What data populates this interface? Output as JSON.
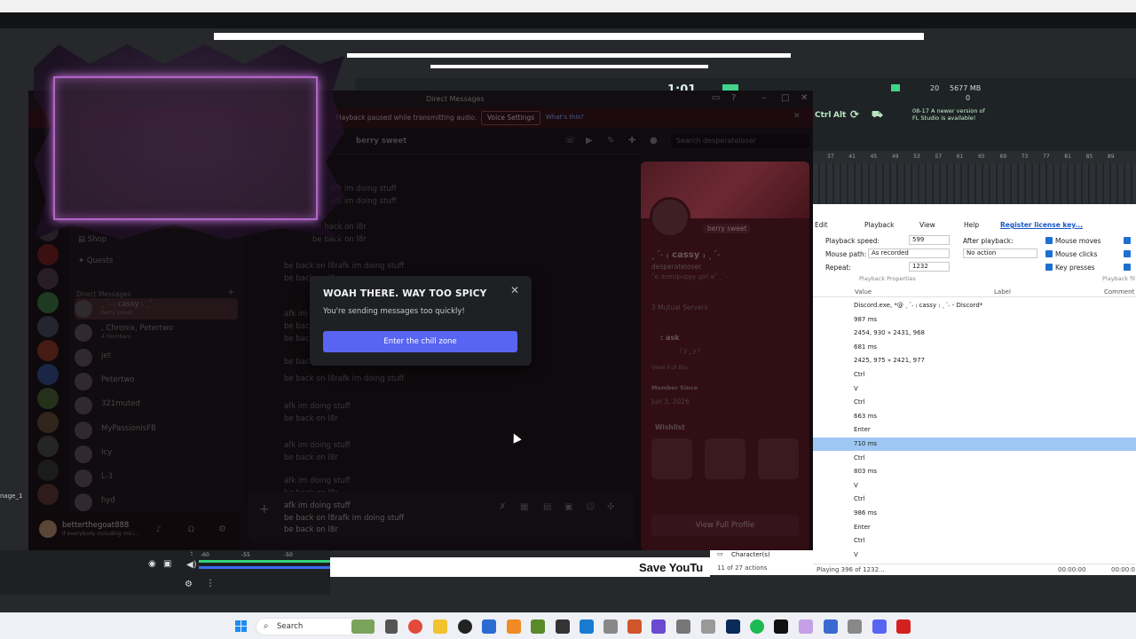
{
  "fl_studio": {
    "time_display": "1:01",
    "cpu": "20",
    "memory": "5677 MB",
    "mem_sub": "0",
    "key_ctrl": "Ctrl",
    "key_alt": "Alt",
    "notice_date": "08-17",
    "notice_line1": "A newer version of",
    "notice_line2": "FL Studio is available!",
    "ruler": [
      "37",
      "41",
      "45",
      "49",
      "53",
      "57",
      "61",
      "65",
      "69",
      "73",
      "77",
      "81",
      "85",
      "89"
    ]
  },
  "macro": {
    "menu": [
      "Edit",
      "Playback",
      "View",
      "Help"
    ],
    "register_link": "Register license key...",
    "playback_speed_label": "Playback speed:",
    "playback_speed": "599",
    "mouse_path_label": "Mouse path:",
    "mouse_path": "As recorded",
    "repeat_label": "Repeat:",
    "repeat": "1232",
    "after_playback_label": "After playback:",
    "after_playback": "No action",
    "checks": [
      "Mouse moves",
      "Mouse clicks",
      "Key presses"
    ],
    "group_playback": "Playback Properties",
    "group_playback2": "Playback fil",
    "columns": [
      "Value",
      "Label",
      "Comment"
    ],
    "rows": [
      "Discord.exe, *@ ˎˊ˗ ₍ cassy ₎ ˎˊ˗ - Discord*",
      "987 ms",
      "2454, 930 » 2431, 968",
      "681 ms",
      "2425, 975 » 2421, 977",
      "Ctrl",
      "V",
      "Ctrl",
      "663 ms",
      "Enter",
      "710 ms",
      "Ctrl",
      "803 ms",
      "V",
      "Ctrl",
      "986 ms",
      "Enter",
      "Ctrl",
      "V"
    ],
    "left_row": "Character(s)",
    "status_left": "11 of 27 actions",
    "status_mid": "Playing 396 of 1232...",
    "status_time1": "00:00:00",
    "status_time2": "00:00:0"
  },
  "obs": {
    "ticks": [
      "-60",
      "-55",
      "-50"
    ],
    "side_label": "nage_1"
  },
  "save_banner": "Save YouTu",
  "discord": {
    "window_title": "Direct Messages",
    "banner_text": "Playback paused while transmitting audio.",
    "banner_button": "Voice Settings",
    "banner_link": "What's this?",
    "nav": [
      "Shop",
      "Quests"
    ],
    "dm_header": "Direct Messages",
    "dms": [
      {
        "name": "ˎˊ˗ ₍ cassy ₎ ˎˊ˗",
        "sub": "berry sweet"
      },
      {
        "name": ", Chronix, Petertwo",
        "sub": "4 Members"
      },
      {
        "name": "jet",
        "sub": ""
      },
      {
        "name": "Petertwo",
        "sub": ""
      },
      {
        "name": "321muted",
        "sub": ""
      },
      {
        "name": "MyPassionIsFB",
        "sub": ""
      },
      {
        "name": "Icy",
        "sub": ""
      },
      {
        "name": "L-3",
        "sub": ""
      },
      {
        "name": "hyd",
        "sub": ""
      }
    ],
    "user_name": "betterthegoat888",
    "user_status": "if everybody including me i...",
    "chat_name": "berry sweet",
    "search_placeholder": "Search desperateloser",
    "messages": [
      "afk im doing stuff",
      "afk im doing stuff",
      "be back on l8r",
      "be back on l8r",
      "be back on l8rafk im doing stuff",
      "be back on l8r",
      "afk im doing stuff",
      "be back on l8r",
      "be back on l8rafk im doing stuff",
      "be back on l8r",
      "be back on l8rafk im doing stuff",
      "afk im doing stuff",
      "be back on l8r",
      "afk im doing stuff",
      "be back on l8r",
      "afk im doing stuff",
      "be back on l8r"
    ],
    "input_lines": [
      "afk im doing stuff",
      "be back on l8rafk im doing stuff",
      "be back on l8r"
    ],
    "profile": {
      "badge": "berry sweet",
      "name": "ˎˊ˗ ₍ cassy ₎ ˎˊ˗",
      "handle": "desperateloser",
      "bio": "˚ʚ doer/puppy girl ɞ˚ ˎˊ˗",
      "mutual": "3 Mutual Servers",
      "ask": ": ask",
      "face": "(ｙ_ｙ)",
      "view_bio": "View Full Bio",
      "member_since_label": "Member Since",
      "member_since": "Jun 3, 2026",
      "wishlist": "Wishlist",
      "view_full": "View Full Profile"
    }
  },
  "modal": {
    "title": "WOAH THERE. WAY TOO SPICY",
    "text": "You're sending messages too quickly!",
    "button": "Enter the chill zone"
  },
  "taskbar": {
    "search": "Search"
  }
}
